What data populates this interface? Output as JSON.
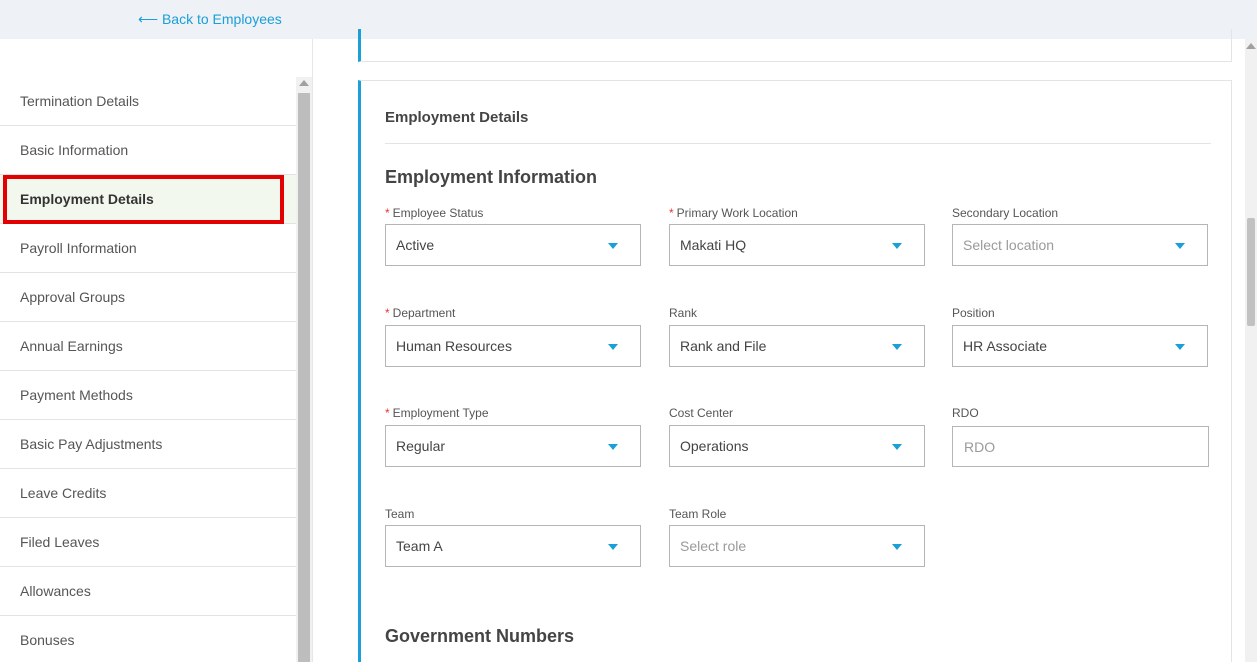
{
  "topbar": {
    "back_label": "⟵ Back to Employees"
  },
  "sidebar": {
    "items": [
      {
        "label": "Termination Details"
      },
      {
        "label": "Basic Information"
      },
      {
        "label": "Employment Details"
      },
      {
        "label": "Payroll Information"
      },
      {
        "label": "Approval Groups"
      },
      {
        "label": "Annual Earnings"
      },
      {
        "label": "Payment Methods"
      },
      {
        "label": "Basic Pay Adjustments"
      },
      {
        "label": "Leave Credits"
      },
      {
        "label": "Filed Leaves"
      },
      {
        "label": "Allowances"
      },
      {
        "label": "Bonuses"
      }
    ],
    "active_index": 2
  },
  "card": {
    "title": "Employment Details",
    "section_employment": "Employment Information",
    "section_government": "Government Numbers"
  },
  "fields": {
    "employee_status": {
      "label": "Employee Status",
      "value": "Active"
    },
    "primary_work_location": {
      "label": "Primary Work Location",
      "value": "Makati HQ"
    },
    "secondary_location": {
      "label": "Secondary Location",
      "placeholder": "Select location"
    },
    "department": {
      "label": "Department",
      "value": "Human Resources"
    },
    "rank": {
      "label": "Rank",
      "value": "Rank and File"
    },
    "position": {
      "label": "Position",
      "value": "HR Associate"
    },
    "employment_type": {
      "label": "Employment Type",
      "value": "Regular"
    },
    "cost_center": {
      "label": "Cost Center",
      "value": "Operations"
    },
    "rdo": {
      "label": "RDO",
      "placeholder": "RDO"
    },
    "team": {
      "label": "Team",
      "value": "Team A"
    },
    "team_role": {
      "label": "Team Role",
      "placeholder": "Select role"
    }
  },
  "required_mark": "*",
  "colors": {
    "accent": "#1a9fd8",
    "highlight": "#e30000",
    "required": "#e33333"
  }
}
